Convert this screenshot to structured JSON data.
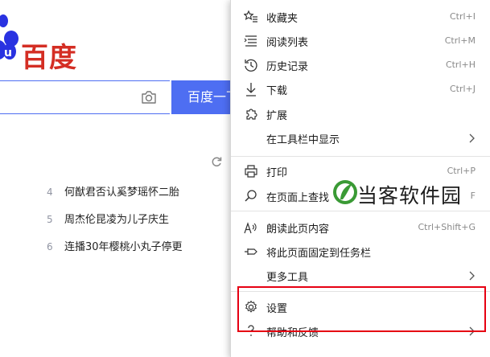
{
  "baidu": {
    "logo_text": "百度",
    "search_button_label": "百度一下",
    "hot_list": [
      {
        "num": "4",
        "text": "何猷君否认奚梦瑶怀二胎"
      },
      {
        "num": "5",
        "text": "周杰伦昆凌为儿子庆生"
      },
      {
        "num": "6",
        "text": "连播30年樱桃小丸子停更"
      }
    ]
  },
  "menu": {
    "items": [
      {
        "label": "收藏夹",
        "shortcut": "Ctrl+I",
        "icon": "favorites-icon"
      },
      {
        "label": "阅读列表",
        "shortcut": "Ctrl+M",
        "icon": "reading-list-icon"
      },
      {
        "label": "历史记录",
        "shortcut": "Ctrl+H",
        "icon": "history-icon"
      },
      {
        "label": "下载",
        "shortcut": "Ctrl+J",
        "icon": "download-icon"
      },
      {
        "label": "扩展",
        "shortcut": "",
        "icon": "extensions-icon"
      },
      {
        "label": "在工具栏中显示",
        "shortcut": "",
        "icon": "",
        "submenu": true
      },
      {
        "label": "打印",
        "shortcut": "Ctrl+P",
        "icon": "print-icon"
      },
      {
        "label": "在页面上查找",
        "shortcut": "F",
        "icon": "find-icon"
      },
      {
        "label": "朗读此页内容",
        "shortcut": "Ctrl+Shift+G",
        "icon": "read-aloud-icon"
      },
      {
        "label": "将此页面固定到任务栏",
        "shortcut": "",
        "icon": "pin-icon"
      },
      {
        "label": "更多工具",
        "shortcut": "",
        "icon": "",
        "submenu": true
      },
      {
        "label": "设置",
        "shortcut": "",
        "icon": "settings-icon"
      },
      {
        "label": "帮助和反馈",
        "shortcut": "",
        "icon": "help-icon",
        "submenu": true
      }
    ]
  },
  "watermark": {
    "text": "当客软件园"
  },
  "colors": {
    "baidu_blue": "#4e6ef2",
    "baidu_red": "#d42e24",
    "highlight_red": "#e60012"
  }
}
